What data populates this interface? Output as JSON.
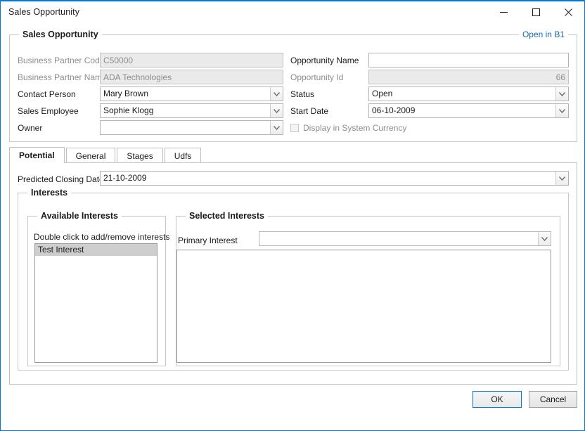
{
  "window": {
    "title": "Sales Opportunity",
    "controls": {
      "minimize": "minimize-button",
      "maximize": "maximize-button",
      "close": "close-button"
    },
    "accent_color": "#0078d7"
  },
  "header_group": {
    "title": "Sales Opportunity",
    "link_label": "Open in B1",
    "link_color": "#1468b4",
    "fields": {
      "business_partner_code": {
        "label": "Business Partner Code",
        "value": "C50000",
        "disabled": true
      },
      "business_partner_name": {
        "label": "Business Partner Name",
        "value": "ADA Technologies",
        "disabled": true
      },
      "contact_person": {
        "label": "Contact Person",
        "value": "Mary Brown",
        "disabled": false
      },
      "sales_employee": {
        "label": "Sales Employee",
        "value": "Sophie Klogg",
        "disabled": false
      },
      "owner": {
        "label": "Owner",
        "value": "",
        "disabled": false
      },
      "opportunity_name": {
        "label": "Opportunity Name",
        "value": "",
        "disabled": false
      },
      "opportunity_id": {
        "label": "Opportunity Id",
        "value": "66",
        "disabled": true
      },
      "status": {
        "label": "Status",
        "value": "Open",
        "disabled": false
      },
      "start_date": {
        "label": "Start Date",
        "value": "06-10-2009",
        "disabled": false
      },
      "display_system_currency": {
        "label": "Display in System Currency",
        "checked": false,
        "disabled": true
      }
    }
  },
  "tabs": [
    {
      "label": "Potential",
      "active": true
    },
    {
      "label": "General",
      "active": false
    },
    {
      "label": "Stages",
      "active": false
    },
    {
      "label": "Udfs",
      "active": false
    }
  ],
  "potential_tab": {
    "predicted_closing_date": {
      "label": "Predicted Closing Date",
      "value": "21-10-2009"
    },
    "interests_group": {
      "title": "Interests",
      "available": {
        "title": "Available Interests",
        "hint": "Double click to add/remove interests",
        "items": [
          {
            "label": "Test Interest",
            "selected": true
          }
        ]
      },
      "selected": {
        "title": "Selected Interests",
        "primary_interest": {
          "label": "Primary Interest",
          "value": ""
        },
        "items": []
      }
    }
  },
  "footer": {
    "ok_label": "OK",
    "cancel_label": "Cancel"
  }
}
